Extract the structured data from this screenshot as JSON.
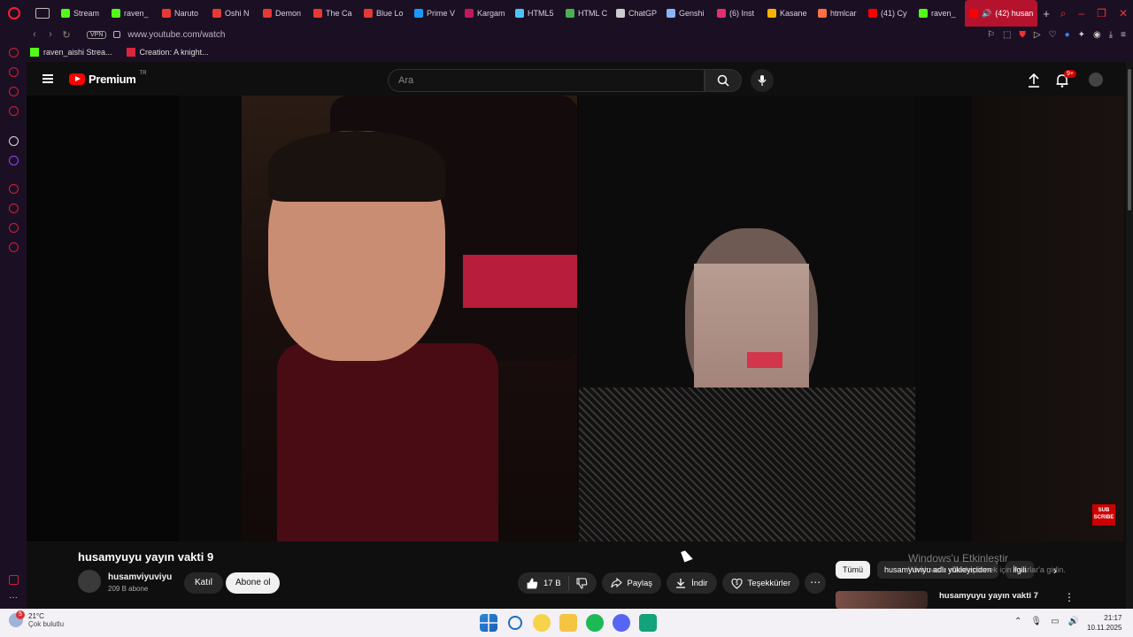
{
  "browser": {
    "tabs": [
      {
        "label": "Stream",
        "color": "#53fc18"
      },
      {
        "label": "raven_",
        "color": "#53fc18"
      },
      {
        "label": "Naruto",
        "color": "#e53935"
      },
      {
        "label": "Oshi N",
        "color": "#e53935"
      },
      {
        "label": "Demon",
        "color": "#e53935"
      },
      {
        "label": "The Ca",
        "color": "#e53935"
      },
      {
        "label": "Blue Lo",
        "color": "#e53935"
      },
      {
        "label": "Prime V",
        "color": "#1a98ff"
      },
      {
        "label": "Kargam",
        "color": "#c2185b"
      },
      {
        "label": "HTML5",
        "color": "#4fc3f7"
      },
      {
        "label": "HTML C",
        "color": "#4caf50"
      },
      {
        "label": "ChatGP",
        "color": "#cccccc"
      },
      {
        "label": "Genshi",
        "color": "#8ab4f8"
      },
      {
        "label": "(6) Inst",
        "color": "#e1306c"
      },
      {
        "label": "Kasane",
        "color": "#f4b400"
      },
      {
        "label": "htmlcar",
        "color": "#ff7043"
      },
      {
        "label": "(41) Cy",
        "color": "#ff0000"
      },
      {
        "label": "raven_",
        "color": "#53fc18"
      }
    ],
    "active_tab": {
      "label": "(42) husan",
      "color": "#ff0000"
    },
    "url": "www.youtube.com/watch",
    "vpn_label": "VPN",
    "bookmarks": [
      {
        "label": "raven_aishi Strea...",
        "color": "#53fc18"
      },
      {
        "label": "Creation: A knight...",
        "color": "#d7263d"
      }
    ]
  },
  "youtube": {
    "logo_text": "Premium",
    "region": "TR",
    "search_placeholder": "Ara",
    "notification_count": "9+",
    "video_title": "husamyuyu yayın vakti 9",
    "channel_name": "husamviyuviyu",
    "subscriber_count": "209 B abone",
    "join_label": "Katıl",
    "subscribe_label": "Abone ol",
    "like_count": "17 B",
    "share_label": "Paylaş",
    "download_label": "İndir",
    "thanks_label": "Teşekkürler",
    "subscribe_overlay": [
      "SUB",
      "SCRIBE"
    ],
    "chips": [
      {
        "label": "Tümü",
        "active": true
      },
      {
        "label": "husamyuviyu adlı yükleyiciden",
        "active": false
      },
      {
        "label": "İlgili",
        "active": false
      }
    ],
    "recommended_title": "husamyuyu yayın vakti 7"
  },
  "windows_activation": {
    "line1": "Windows'u Etkinleştir",
    "line2": "Windows'u etkinleştirmek için Ayarlar'a gidin."
  },
  "taskbar": {
    "temperature": "21°C",
    "weather": "Çok bulutlu",
    "weather_badge": "5",
    "time": "21:17",
    "date": "10.11.2025"
  }
}
